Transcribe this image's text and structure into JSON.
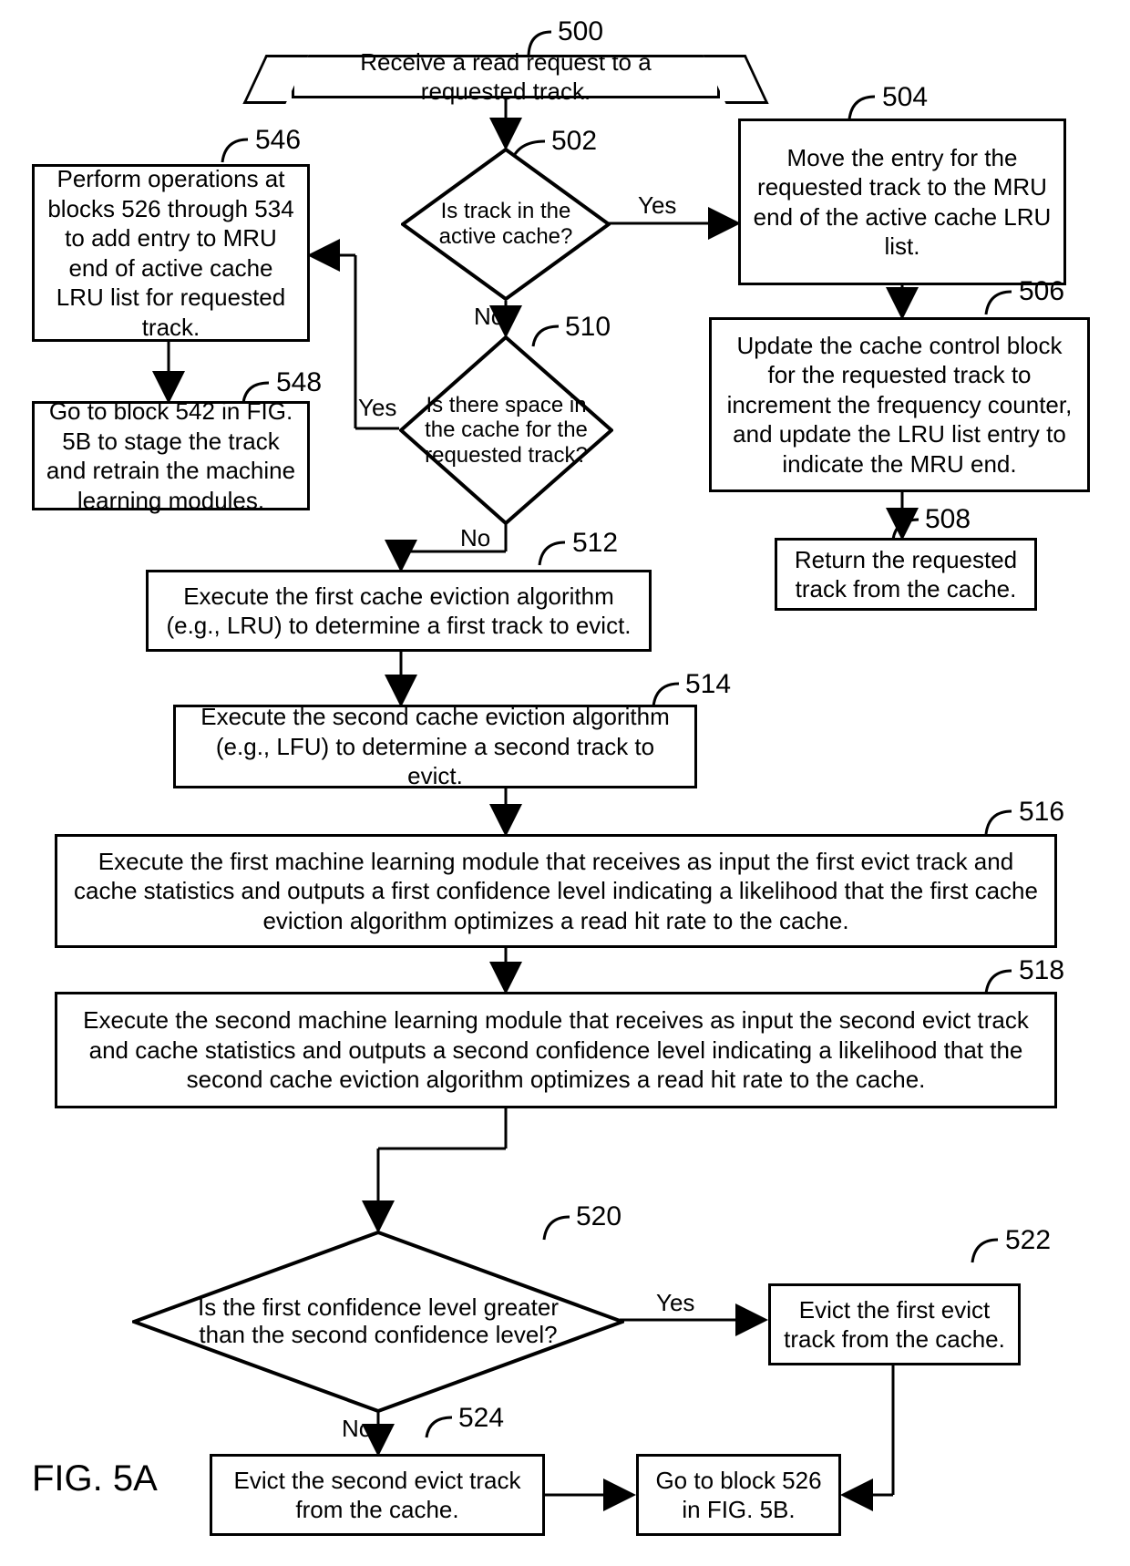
{
  "figure_label": "FIG. 5A",
  "nodes": {
    "n500": {
      "ref": "500",
      "text": "Receive a read request to a requested track."
    },
    "n502": {
      "ref": "502",
      "text": "Is track in the active cache?",
      "yes": "Yes",
      "no": "No"
    },
    "n504": {
      "ref": "504",
      "text": "Move the entry for the requested track to the MRU end of the active cache LRU list."
    },
    "n506": {
      "ref": "506",
      "text": "Update the cache control block for the requested track to increment the frequency counter, and update the LRU list entry to indicate the MRU end."
    },
    "n508": {
      "ref": "508",
      "text": "Return the requested track from the cache."
    },
    "n510": {
      "ref": "510",
      "text": "Is there space in the cache for the requested track?",
      "yes": "Yes",
      "no": "No"
    },
    "n512": {
      "ref": "512",
      "text": "Execute the first cache eviction algorithm (e.g., LRU) to determine a first track to evict."
    },
    "n514": {
      "ref": "514",
      "text": "Execute the second cache eviction algorithm (e.g., LFU) to determine a second track to evict."
    },
    "n516": {
      "ref": "516",
      "text": "Execute the first machine learning module that receives as input the first evict track and cache statistics and outputs a first confidence level indicating a likelihood that the first cache eviction algorithm optimizes a read hit rate to the cache."
    },
    "n518": {
      "ref": "518",
      "text": "Execute the second machine learning module that receives as input the second evict track and cache statistics and outputs a second confidence level indicating a likelihood that the second cache eviction algorithm optimizes a read hit rate to the cache."
    },
    "n520": {
      "ref": "520",
      "text": "Is the first confidence level greater than the second confidence level?",
      "yes": "Yes",
      "no": "No"
    },
    "n522": {
      "ref": "522",
      "text": "Evict the first evict track from the cache."
    },
    "n524": {
      "ref": "524",
      "text": "Evict the second evict track from the cache."
    },
    "n526link": {
      "text": "Go to block 526 in FIG. 5B."
    },
    "n546": {
      "ref": "546",
      "text": "Perform operations at blocks 526 through 534 to add entry to MRU end of active cache LRU list for requested track."
    },
    "n548": {
      "ref": "548",
      "text": "Go to block 542 in FIG. 5B to stage the track and retrain the machine learning modules."
    }
  }
}
